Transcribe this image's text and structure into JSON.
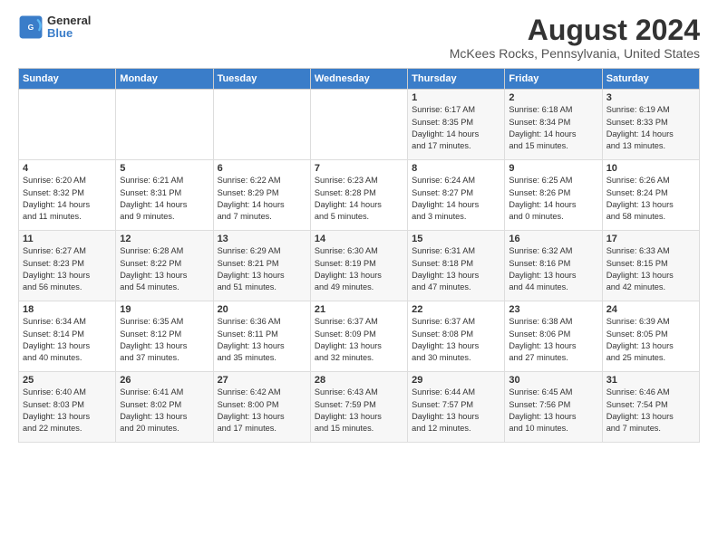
{
  "logo": {
    "line1": "General",
    "line2": "Blue"
  },
  "title": "August 2024",
  "subtitle": "McKees Rocks, Pennsylvania, United States",
  "days_header": [
    "Sunday",
    "Monday",
    "Tuesday",
    "Wednesday",
    "Thursday",
    "Friday",
    "Saturday"
  ],
  "weeks": [
    [
      {
        "num": "",
        "info": ""
      },
      {
        "num": "",
        "info": ""
      },
      {
        "num": "",
        "info": ""
      },
      {
        "num": "",
        "info": ""
      },
      {
        "num": "1",
        "info": "Sunrise: 6:17 AM\nSunset: 8:35 PM\nDaylight: 14 hours\nand 17 minutes."
      },
      {
        "num": "2",
        "info": "Sunrise: 6:18 AM\nSunset: 8:34 PM\nDaylight: 14 hours\nand 15 minutes."
      },
      {
        "num": "3",
        "info": "Sunrise: 6:19 AM\nSunset: 8:33 PM\nDaylight: 14 hours\nand 13 minutes."
      }
    ],
    [
      {
        "num": "4",
        "info": "Sunrise: 6:20 AM\nSunset: 8:32 PM\nDaylight: 14 hours\nand 11 minutes."
      },
      {
        "num": "5",
        "info": "Sunrise: 6:21 AM\nSunset: 8:31 PM\nDaylight: 14 hours\nand 9 minutes."
      },
      {
        "num": "6",
        "info": "Sunrise: 6:22 AM\nSunset: 8:29 PM\nDaylight: 14 hours\nand 7 minutes."
      },
      {
        "num": "7",
        "info": "Sunrise: 6:23 AM\nSunset: 8:28 PM\nDaylight: 14 hours\nand 5 minutes."
      },
      {
        "num": "8",
        "info": "Sunrise: 6:24 AM\nSunset: 8:27 PM\nDaylight: 14 hours\nand 3 minutes."
      },
      {
        "num": "9",
        "info": "Sunrise: 6:25 AM\nSunset: 8:26 PM\nDaylight: 14 hours\nand 0 minutes."
      },
      {
        "num": "10",
        "info": "Sunrise: 6:26 AM\nSunset: 8:24 PM\nDaylight: 13 hours\nand 58 minutes."
      }
    ],
    [
      {
        "num": "11",
        "info": "Sunrise: 6:27 AM\nSunset: 8:23 PM\nDaylight: 13 hours\nand 56 minutes."
      },
      {
        "num": "12",
        "info": "Sunrise: 6:28 AM\nSunset: 8:22 PM\nDaylight: 13 hours\nand 54 minutes."
      },
      {
        "num": "13",
        "info": "Sunrise: 6:29 AM\nSunset: 8:21 PM\nDaylight: 13 hours\nand 51 minutes."
      },
      {
        "num": "14",
        "info": "Sunrise: 6:30 AM\nSunset: 8:19 PM\nDaylight: 13 hours\nand 49 minutes."
      },
      {
        "num": "15",
        "info": "Sunrise: 6:31 AM\nSunset: 8:18 PM\nDaylight: 13 hours\nand 47 minutes."
      },
      {
        "num": "16",
        "info": "Sunrise: 6:32 AM\nSunset: 8:16 PM\nDaylight: 13 hours\nand 44 minutes."
      },
      {
        "num": "17",
        "info": "Sunrise: 6:33 AM\nSunset: 8:15 PM\nDaylight: 13 hours\nand 42 minutes."
      }
    ],
    [
      {
        "num": "18",
        "info": "Sunrise: 6:34 AM\nSunset: 8:14 PM\nDaylight: 13 hours\nand 40 minutes."
      },
      {
        "num": "19",
        "info": "Sunrise: 6:35 AM\nSunset: 8:12 PM\nDaylight: 13 hours\nand 37 minutes."
      },
      {
        "num": "20",
        "info": "Sunrise: 6:36 AM\nSunset: 8:11 PM\nDaylight: 13 hours\nand 35 minutes."
      },
      {
        "num": "21",
        "info": "Sunrise: 6:37 AM\nSunset: 8:09 PM\nDaylight: 13 hours\nand 32 minutes."
      },
      {
        "num": "22",
        "info": "Sunrise: 6:37 AM\nSunset: 8:08 PM\nDaylight: 13 hours\nand 30 minutes."
      },
      {
        "num": "23",
        "info": "Sunrise: 6:38 AM\nSunset: 8:06 PM\nDaylight: 13 hours\nand 27 minutes."
      },
      {
        "num": "24",
        "info": "Sunrise: 6:39 AM\nSunset: 8:05 PM\nDaylight: 13 hours\nand 25 minutes."
      }
    ],
    [
      {
        "num": "25",
        "info": "Sunrise: 6:40 AM\nSunset: 8:03 PM\nDaylight: 13 hours\nand 22 minutes."
      },
      {
        "num": "26",
        "info": "Sunrise: 6:41 AM\nSunset: 8:02 PM\nDaylight: 13 hours\nand 20 minutes."
      },
      {
        "num": "27",
        "info": "Sunrise: 6:42 AM\nSunset: 8:00 PM\nDaylight: 13 hours\nand 17 minutes."
      },
      {
        "num": "28",
        "info": "Sunrise: 6:43 AM\nSunset: 7:59 PM\nDaylight: 13 hours\nand 15 minutes."
      },
      {
        "num": "29",
        "info": "Sunrise: 6:44 AM\nSunset: 7:57 PM\nDaylight: 13 hours\nand 12 minutes."
      },
      {
        "num": "30",
        "info": "Sunrise: 6:45 AM\nSunset: 7:56 PM\nDaylight: 13 hours\nand 10 minutes."
      },
      {
        "num": "31",
        "info": "Sunrise: 6:46 AM\nSunset: 7:54 PM\nDaylight: 13 hours\nand 7 minutes."
      }
    ]
  ]
}
